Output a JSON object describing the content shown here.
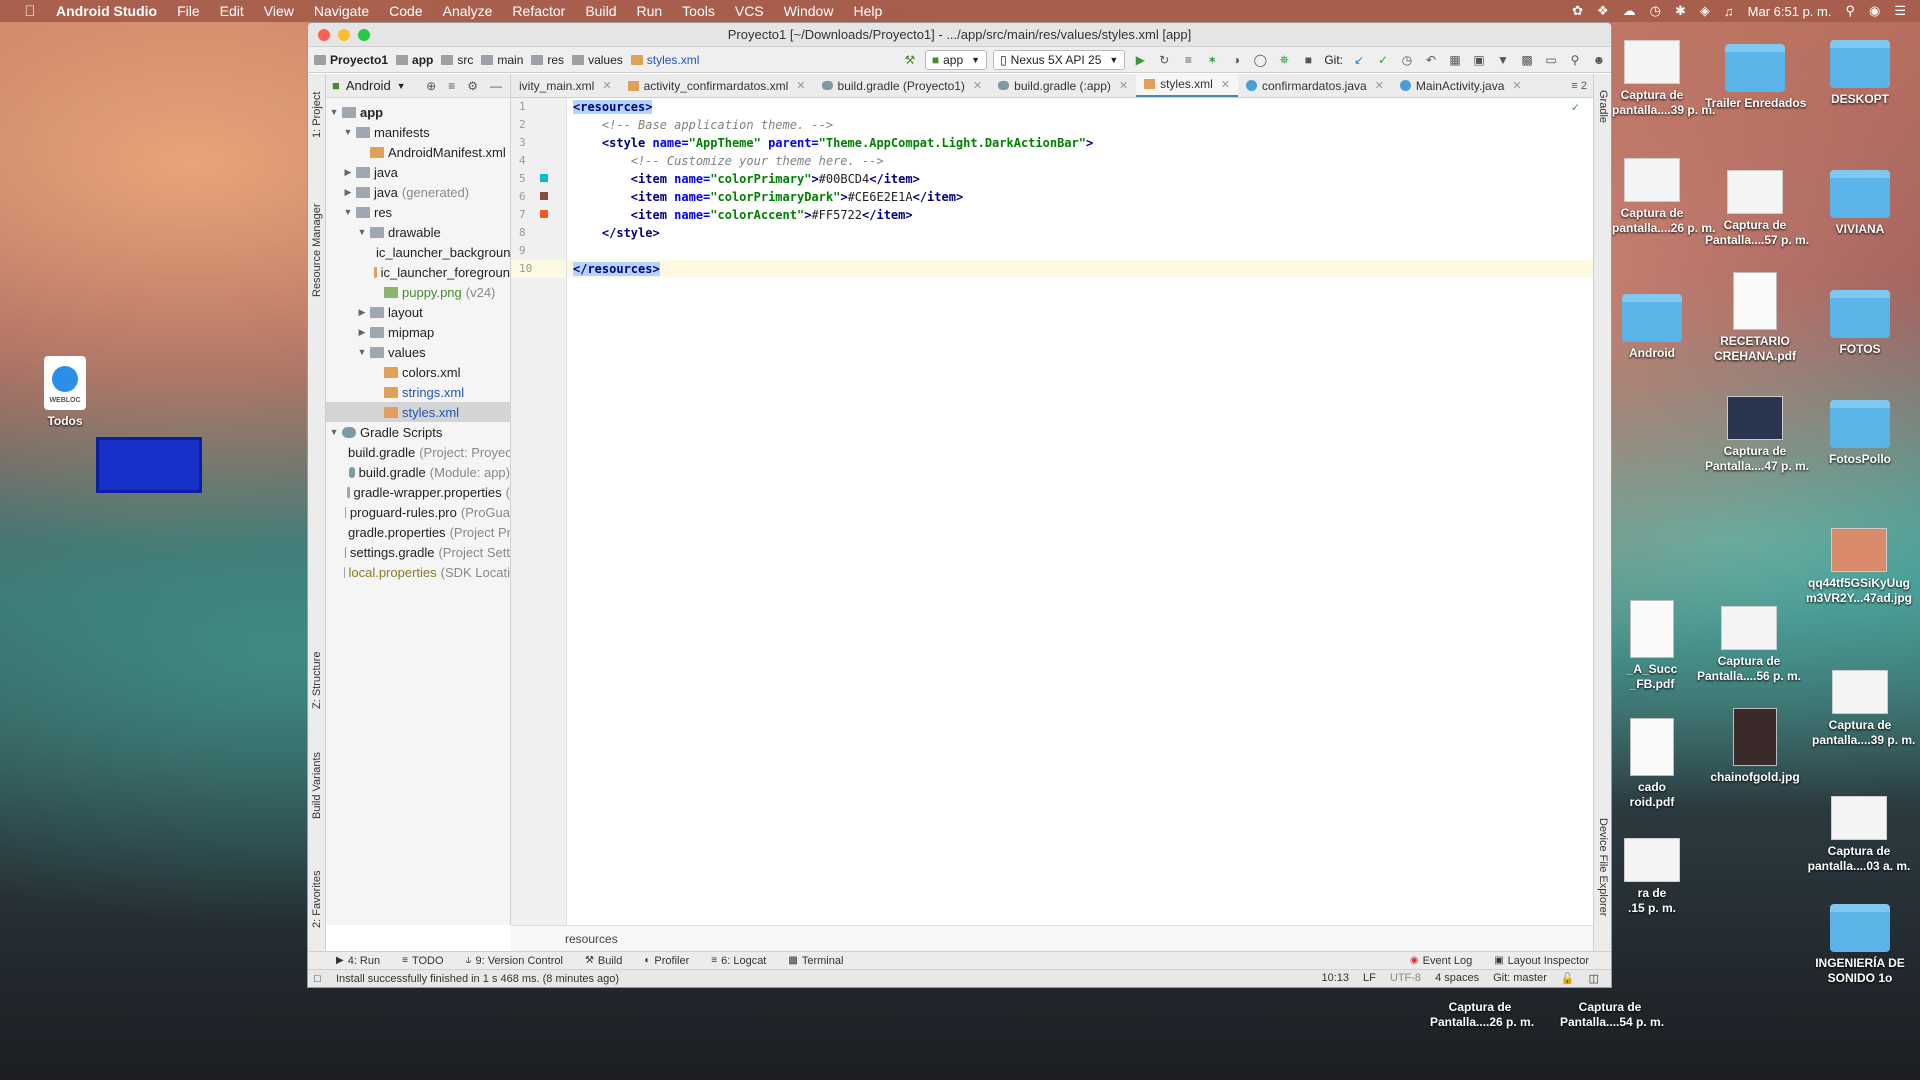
{
  "menubar": {
    "app_name": "Android Studio",
    "items": [
      "File",
      "Edit",
      "View",
      "Navigate",
      "Code",
      "Analyze",
      "Refactor",
      "Build",
      "Run",
      "Tools",
      "VCS",
      "Window",
      "Help"
    ],
    "clock": "Mar 6:51 p. m."
  },
  "desktop": {
    "left_icon": {
      "label": "Todos",
      "badge": "WEBLOC"
    },
    "icons": [
      {
        "label": "Captura de\npantalla....39 p. m."
      },
      {
        "label": "Trailer Enredados"
      },
      {
        "label": "DESKOPT"
      },
      {
        "label": "Captura de\npantalla....26 p. m."
      },
      {
        "label": "Captura de\nPantalla....57 p. m."
      },
      {
        "label": "VIVIANA"
      },
      {
        "label": "Android"
      },
      {
        "label": "RECETARIO\nCREHANA.pdf"
      },
      {
        "label": "FOTOS"
      },
      {
        "label": "Captura de\nPantalla....47 p. m."
      },
      {
        "label": "FotosPollo"
      },
      {
        "label": "qq44tf5GSiKyUug\nm3VR2Y...47ad.jpg"
      },
      {
        "label": "_A_Succ\n_FB.pdf"
      },
      {
        "label": "Captura de\nPantalla....56 p. m."
      },
      {
        "label": "Captura de\npantalla....39 p. m."
      },
      {
        "label": "cado\nroid.pdf"
      },
      {
        "label": "chainofgold.jpg"
      },
      {
        "label": "Captura de\npantalla....03 a. m."
      },
      {
        "label": "ra de\n.15 p. m."
      },
      {
        "label": "INGENIERÍA DE\nSONIDO 1o"
      },
      {
        "label": "Captura de\nPantalla....26 p. m."
      },
      {
        "label": "Captura de\nPantalla....54 p. m."
      }
    ]
  },
  "window": {
    "title": "Proyecto1 [~/Downloads/Proyecto1] - .../app/src/main/res/values/styles.xml [app]",
    "breadcrumbs": [
      "Proyecto1",
      "app",
      "src",
      "main",
      "res",
      "values",
      "styles.xml"
    ],
    "run_config": "app",
    "device": "Nexus 5X API 25",
    "git_label": "Git:"
  },
  "project_panel": {
    "view_mode": "Android",
    "tree": [
      {
        "label": "app",
        "sub": ""
      },
      {
        "label": "manifests",
        "sub": ""
      },
      {
        "label": "AndroidManifest.xml",
        "sub": ""
      },
      {
        "label": "java",
        "sub": ""
      },
      {
        "label": "java",
        "sub": "(generated)"
      },
      {
        "label": "res",
        "sub": ""
      },
      {
        "label": "drawable",
        "sub": ""
      },
      {
        "label": "ic_launcher_backgroun",
        "sub": ""
      },
      {
        "label": "ic_launcher_foregroun",
        "sub": ""
      },
      {
        "label": "puppy.png",
        "sub": "(v24)"
      },
      {
        "label": "layout",
        "sub": ""
      },
      {
        "label": "mipmap",
        "sub": ""
      },
      {
        "label": "values",
        "sub": ""
      },
      {
        "label": "colors.xml",
        "sub": ""
      },
      {
        "label": "strings.xml",
        "sub": ""
      },
      {
        "label": "styles.xml",
        "sub": ""
      },
      {
        "label": "Gradle Scripts",
        "sub": ""
      },
      {
        "label": "build.gradle",
        "sub": "(Project: Proyec"
      },
      {
        "label": "build.gradle",
        "sub": "(Module: app)"
      },
      {
        "label": "gradle-wrapper.properties",
        "sub": "("
      },
      {
        "label": "proguard-rules.pro",
        "sub": "(ProGua"
      },
      {
        "label": "gradle.properties",
        "sub": "(Project Pr"
      },
      {
        "label": "settings.gradle",
        "sub": "(Project Sett"
      },
      {
        "label": "local.properties",
        "sub": "(SDK Locati"
      }
    ]
  },
  "side_tabs": {
    "left": [
      "1: Project",
      "Resource Manager",
      "Z: Structure",
      "Build Variants",
      "2: Favorites"
    ],
    "right": [
      "Gradle",
      "Device File Explorer"
    ]
  },
  "editor": {
    "tabs": [
      "ivity_main.xml",
      "activity_confirmardatos.xml",
      "build.gradle (Proyecto1)",
      "build.gradle (:app)",
      "styles.xml",
      "confirmardatos.java",
      "MainActivity.java"
    ],
    "tab_overflow": "≡ 2",
    "line_numbers": [
      "1",
      "2",
      "3",
      "4",
      "5",
      "6",
      "7",
      "8",
      "9",
      "10"
    ],
    "colors": {
      "colorPrimary": "#00BCD4",
      "colorPrimaryDark": "#CE6E2E1A",
      "colorAccent": "#FF5722"
    },
    "lines": {
      "l1": "<resources>",
      "l2": "    <!-- Base application theme. -->",
      "l3_open": "    <style ",
      "l3_name_attr": "name=",
      "l3_name_val": "\"AppTheme\"",
      "l3_parent_attr": " parent=",
      "l3_parent_val": "\"Theme.AppCompat.Light.DarkActionBar\"",
      "l3_close": ">",
      "l4": "        <!-- Customize your theme here. -->",
      "items": [
        {
          "name": "\"colorPrimary\"",
          "value": "#00BCD4"
        },
        {
          "name": "\"colorPrimaryDark\"",
          "value": "#CE6E2E1A"
        },
        {
          "name": "\"colorAccent\"",
          "value": "#FF5722"
        }
      ],
      "l8": "    </style>",
      "l10": "</resources>"
    },
    "breadcrumb": "resources"
  },
  "bottom_tools": {
    "run": "4: Run",
    "todo": "TODO",
    "vcs": "9: Version Control",
    "build": "Build",
    "profiler": "Profiler",
    "logcat": "6: Logcat",
    "terminal": "Terminal",
    "event_log": "Event Log",
    "layout_inspector": "Layout Inspector"
  },
  "status": {
    "message": "Install successfully finished in 1 s 468 ms. (8 minutes ago)",
    "position": "10:13",
    "line_sep": "LF",
    "encoding": "UTF-8",
    "indent": "4 spaces",
    "branch": "Git: master"
  }
}
